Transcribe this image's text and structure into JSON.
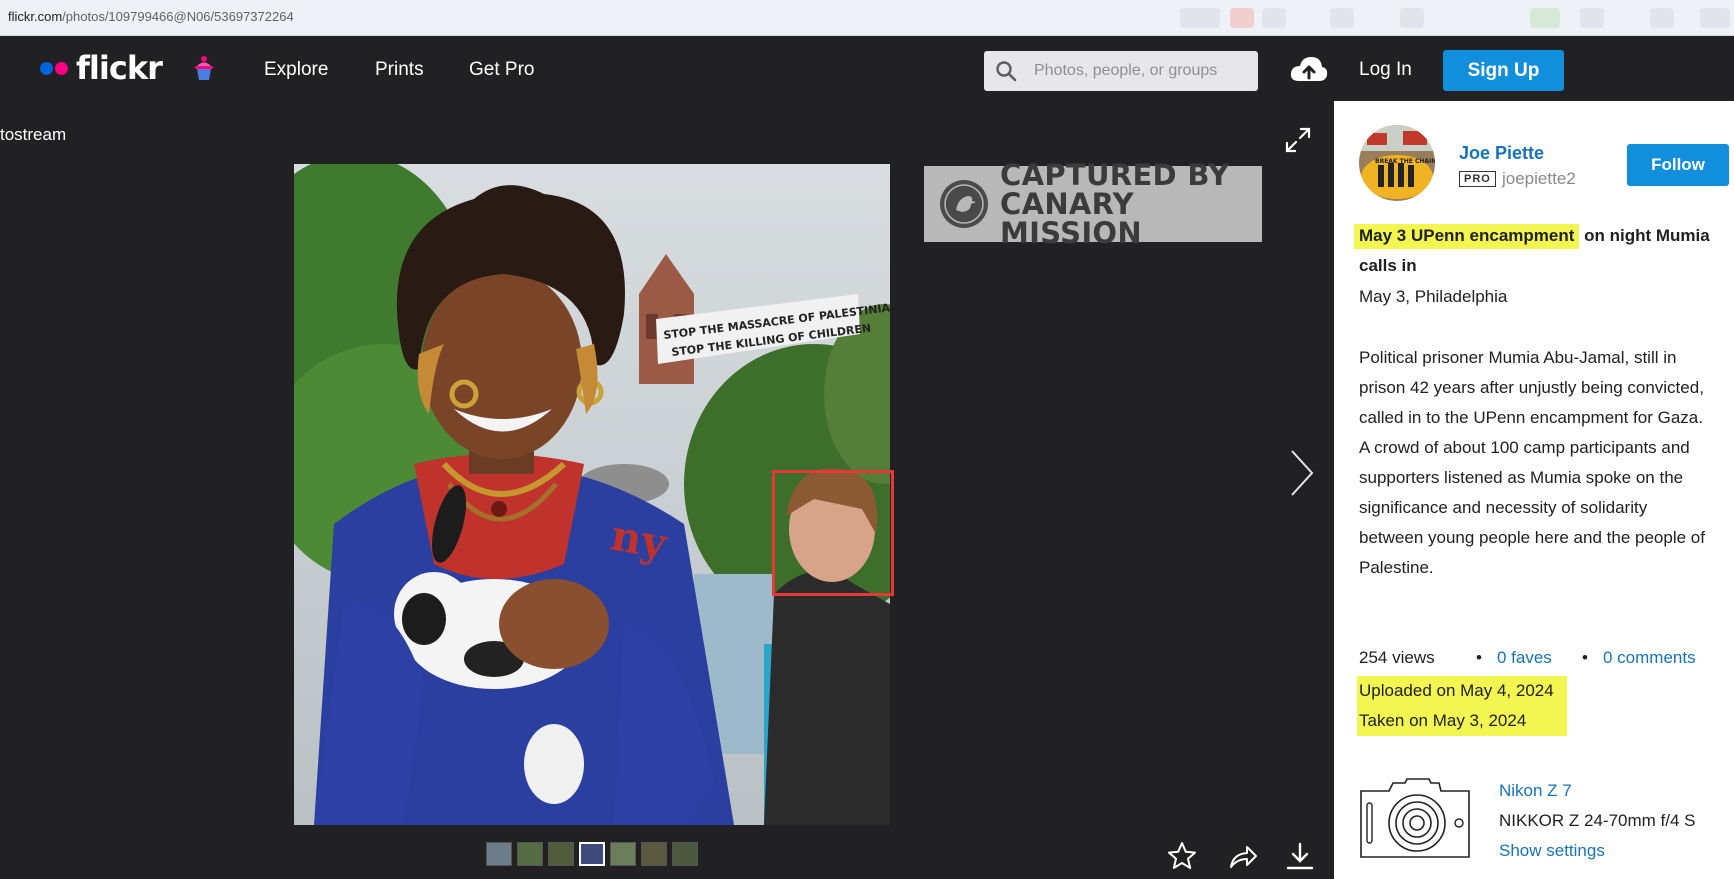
{
  "browser": {
    "url_host": "flickr.com",
    "url_path": "/photos/109799466@N06/53697372264"
  },
  "nav": {
    "logo": "flickr",
    "links": [
      "Explore",
      "Prints",
      "Get Pro"
    ],
    "search_placeholder": "Photos, people, or groups",
    "login": "Log In",
    "signup": "Sign Up"
  },
  "viewer": {
    "back_label": "tostream",
    "watermark_line1": "CAPTURED BY",
    "watermark_line2": "CANARY MISSION",
    "banner_line1": "STOP THE MASSACRE OF PALESTINIANS",
    "banner_line2": "STOP THE KILLING OF CHILDREN",
    "thumbnail_count": 7,
    "active_thumbnail": 4
  },
  "sidebar": {
    "author_name": "Joe Piette",
    "pro_badge": "PRO",
    "username": "joepiette2",
    "follow_label": "Follow",
    "title_highlighted": "May 3 UPenn encampment",
    "title_rest": " on night Mumia calls in",
    "subtitle": "May 3, Philadelphia",
    "description": "Political prisoner Mumia Abu-Jamal, still in prison 42 years after unjustly being convicted, called in to the UPenn encampment for Gaza. A crowd of about 100 camp participants and supporters listened as Mumia spoke on the significance and necessity of solidarity between young people here and the people of Palestine.",
    "views": "254 views",
    "faves": "0 faves",
    "comments": "0 comments",
    "bullet": "•",
    "uploaded": "Uploaded on May 4, 2024",
    "taken": "Taken on May 3, 2024",
    "camera_model": "Nikon Z 7",
    "lens": "NIKKOR Z 24-70mm f/4 S",
    "show_settings": "Show settings"
  },
  "colors": {
    "nav_bg": "#212124",
    "accent_blue": "#128fdc",
    "link_blue": "#1573b9",
    "highlight_yellow": "#f3f650",
    "face_box_red": "#e53935"
  },
  "icons": [
    "search-icon",
    "upload-cloud-icon",
    "expand-icon",
    "next-arrow-icon",
    "star-icon",
    "share-icon",
    "download-icon",
    "camera-icon"
  ]
}
